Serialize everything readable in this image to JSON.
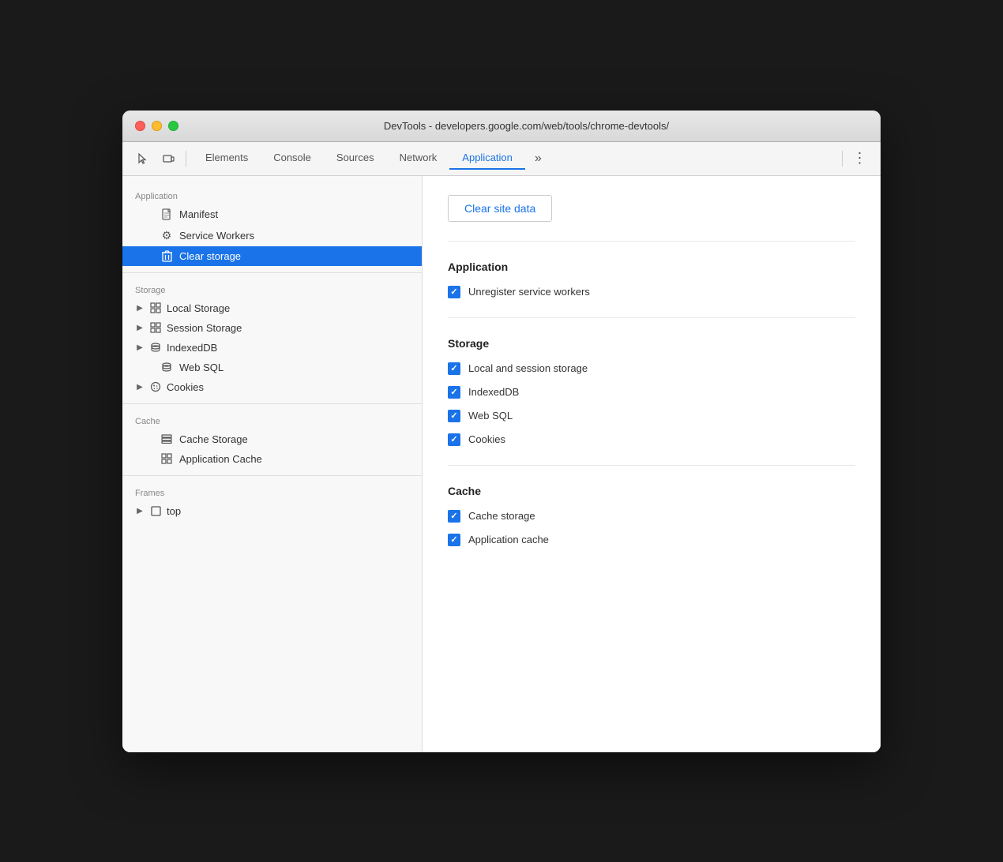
{
  "window": {
    "title": "DevTools - developers.google.com/web/tools/chrome-devtools/",
    "traffic_lights": {
      "close_label": "close",
      "minimize_label": "minimize",
      "maximize_label": "maximize"
    }
  },
  "toolbar": {
    "cursor_icon": "cursor-icon",
    "responsive_icon": "responsive-icon",
    "more_label": "»",
    "menu_label": "⋮"
  },
  "tabs": [
    {
      "label": "Elements",
      "active": false
    },
    {
      "label": "Console",
      "active": false
    },
    {
      "label": "Sources",
      "active": false
    },
    {
      "label": "Network",
      "active": false
    },
    {
      "label": "Application",
      "active": true
    }
  ],
  "sidebar": {
    "sections": [
      {
        "header": "Application",
        "items": [
          {
            "label": "Manifest",
            "icon": "doc",
            "expandable": false,
            "active": false
          },
          {
            "label": "Service Workers",
            "icon": "gear",
            "expandable": false,
            "active": false
          },
          {
            "label": "Clear storage",
            "icon": "trash",
            "expandable": false,
            "active": true
          }
        ]
      },
      {
        "header": "Storage",
        "items": [
          {
            "label": "Local Storage",
            "icon": "grid",
            "expandable": true,
            "active": false
          },
          {
            "label": "Session Storage",
            "icon": "grid",
            "expandable": true,
            "active": false
          },
          {
            "label": "IndexedDB",
            "icon": "db",
            "expandable": true,
            "active": false
          },
          {
            "label": "Web SQL",
            "icon": "db",
            "expandable": false,
            "active": false
          },
          {
            "label": "Cookies",
            "icon": "cookie",
            "expandable": true,
            "active": false
          }
        ]
      },
      {
        "header": "Cache",
        "items": [
          {
            "label": "Cache Storage",
            "icon": "layers",
            "expandable": false,
            "active": false
          },
          {
            "label": "Application Cache",
            "icon": "grid",
            "expandable": false,
            "active": false
          }
        ]
      },
      {
        "header": "Frames",
        "items": [
          {
            "label": "top",
            "icon": "frame",
            "expandable": true,
            "active": false
          }
        ]
      }
    ]
  },
  "content": {
    "clear_button_label": "Clear site data",
    "sections": [
      {
        "title": "Application",
        "checkboxes": [
          {
            "label": "Unregister service workers",
            "checked": true
          }
        ]
      },
      {
        "title": "Storage",
        "checkboxes": [
          {
            "label": "Local and session storage",
            "checked": true
          },
          {
            "label": "IndexedDB",
            "checked": true
          },
          {
            "label": "Web SQL",
            "checked": true
          },
          {
            "label": "Cookies",
            "checked": true
          }
        ]
      },
      {
        "title": "Cache",
        "checkboxes": [
          {
            "label": "Cache storage",
            "checked": true
          },
          {
            "label": "Application cache",
            "checked": true
          }
        ]
      }
    ]
  },
  "colors": {
    "accent": "#1a73e8",
    "active_tab_border": "#1a73e8",
    "active_sidebar_bg": "#1a73e8",
    "checkbox_bg": "#1a73e8"
  }
}
